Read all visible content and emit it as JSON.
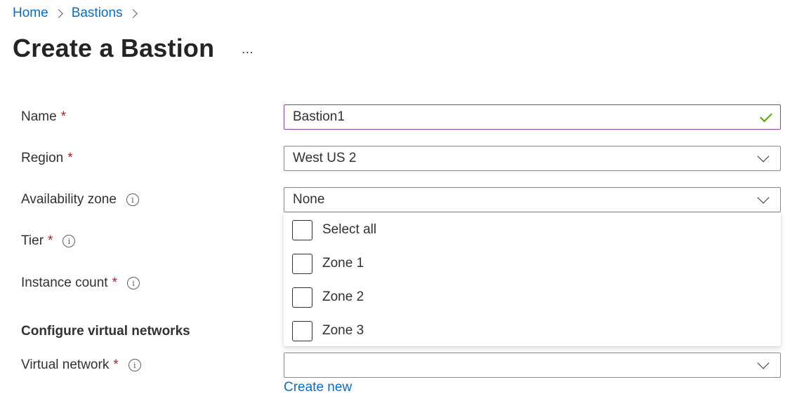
{
  "breadcrumb": {
    "items": [
      {
        "label": "Home"
      },
      {
        "label": "Bastions"
      }
    ]
  },
  "header": {
    "title": "Create a Bastion",
    "more_label": "…"
  },
  "form": {
    "required_marker": "*",
    "info_glyph": "i",
    "name": {
      "label": "Name",
      "value": "Bastion1",
      "status_icon": "checkmark-icon",
      "status_color": "#57a300"
    },
    "region": {
      "label": "Region",
      "value": "West US 2"
    },
    "availability_zone": {
      "label": "Availability zone",
      "value": "None",
      "expanded": true,
      "options": [
        {
          "label": "Select all",
          "checked": false
        },
        {
          "label": "Zone 1",
          "checked": false
        },
        {
          "label": "Zone 2",
          "checked": false
        },
        {
          "label": "Zone 3",
          "checked": false
        }
      ]
    },
    "tier": {
      "label": "Tier"
    },
    "instance_count": {
      "label": "Instance count"
    },
    "section_vnet": {
      "heading": "Configure virtual networks"
    },
    "virtual_network": {
      "label": "Virtual network",
      "value": "",
      "create_new_label": "Create new"
    }
  },
  "colors": {
    "link": "#0f6cbd",
    "required": "#a4262c",
    "focus_border": "#8a3ea8",
    "valid_check": "#57a300"
  }
}
